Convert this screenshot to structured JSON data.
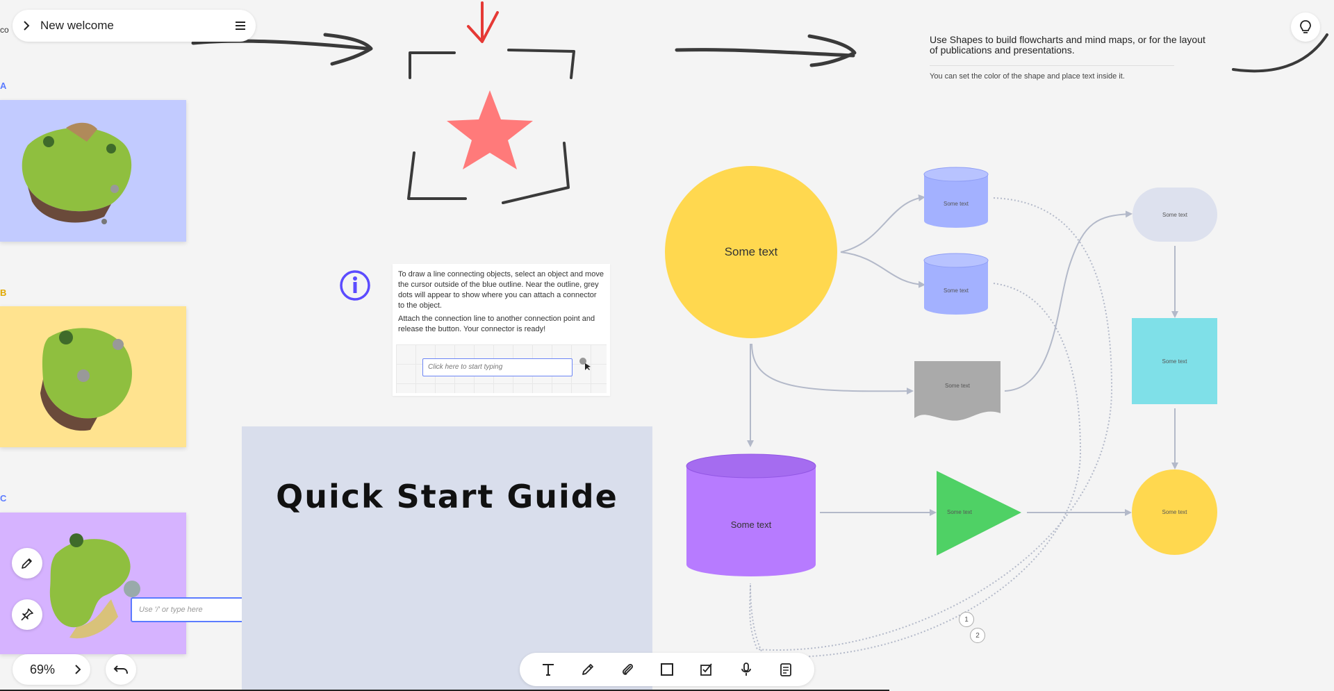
{
  "header": {
    "board_title": "New welcome",
    "edge_text": "co"
  },
  "left_cards": {
    "letters": [
      "A",
      "B",
      "C"
    ]
  },
  "mini_input": {
    "placeholder": "Use '/' or type here"
  },
  "zoom": {
    "value": "69%"
  },
  "info_panel": {
    "paragraph1": "To draw a line connecting objects, select an object and move the cursor outside of the blue outline. Near the outline, grey dots will appear to show where you can attach a connector to the object.",
    "paragraph2": "Attach the connection line to another connection point and release the button. Your connector is ready!",
    "demo_placeholder": "Click here to start typing"
  },
  "quick_start": {
    "title": "Quick Start Guide"
  },
  "shapes_info": {
    "title": "Use Shapes to build flowcharts and mind maps, or for the layout of publications and presentations.",
    "subtitle": "You can set the color of the shape and place text inside it."
  },
  "flowchart": {
    "big_circle": "Some text",
    "cylinder_top": "Some text",
    "cylinder_mid": "Some text",
    "document_shape": "Some text",
    "purple_cylinder": "Some text",
    "green_triangle": "Some text",
    "pill": "Some text",
    "cyan_rect": "Some text",
    "yellow_circle": "Some text",
    "badge1": "1",
    "badge2": "2"
  },
  "colors": {
    "accent_blue": "#5b7bff",
    "card_blue": "#c2cbff",
    "card_yellow": "#ffe38f",
    "card_purple": "#d6b3ff",
    "star": "#ff7a7a",
    "shape_yellow": "#ffd84f",
    "shape_cylinder_blue": "#a3b1ff",
    "shape_purple": "#b77bff",
    "shape_green": "#4fd165",
    "shape_cyan": "#7fe0e8",
    "plus_green": "#0f8a3a"
  },
  "toolbar": {
    "tools": [
      "text-icon",
      "pen-icon",
      "attach-icon",
      "shape-icon",
      "task-icon",
      "microphone-icon",
      "notes-icon"
    ]
  }
}
